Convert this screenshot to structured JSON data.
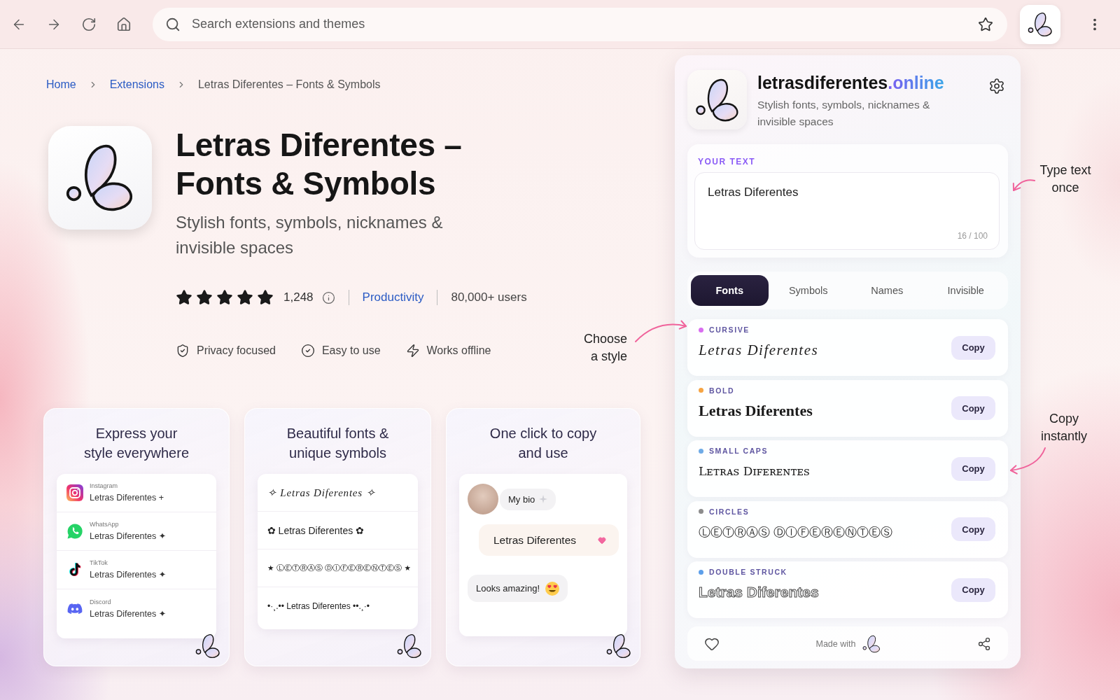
{
  "browser": {
    "search": {
      "placeholder": "Search extensions and themes"
    }
  },
  "breadcrumb": [
    {
      "label": "Home",
      "kind": "link"
    },
    {
      "label": "Extensions",
      "kind": "link"
    },
    {
      "label": "Letras Diferentes – Fonts & Symbols",
      "kind": "current"
    }
  ],
  "extension": {
    "title": "Letras Diferentes – Fonts & Symbols",
    "subtitle": "Stylish fonts, symbols, nicknames & invisible spaces",
    "stars": 5,
    "rating_count": "1,248",
    "category": "Productivity",
    "users": "80,000+ users",
    "features": [
      {
        "kind": "privacy",
        "label": "Privacy focused"
      },
      {
        "kind": "easy",
        "label": "Easy to use"
      },
      {
        "kind": "offline",
        "label": "Works offline"
      }
    ]
  },
  "showcase": [
    {
      "kind": "apps",
      "title": "Express your style everywhere",
      "rows": [
        {
          "kind": "instagram",
          "app": "Instagram",
          "text": "Letras Diferentes +"
        },
        {
          "kind": "whatsapp",
          "app": "WhatsApp",
          "text": "Letras Diferentes ✦"
        },
        {
          "kind": "tiktok",
          "app": "TikTok",
          "text": "Letras Diferentes ✦"
        },
        {
          "kind": "discord",
          "app": "Discord",
          "text": "Letras Diferentes ✦"
        }
      ]
    },
    {
      "kind": "symbols",
      "title": "Beautiful fonts & unique symbols",
      "rows": [
        {
          "kind": "italic",
          "text": "✧ Letras Diferentes ✧"
        },
        {
          "kind": "plain",
          "text": "✿ Letras Diferentes ✿"
        },
        {
          "kind": "circles",
          "text": "★ ⓁⒺⓉⓇⒶⓈ ⒹⒾⒻⒺⓇⒺⓃⓉⒺⓈ ★"
        },
        {
          "kind": "small",
          "text": "•·¸.•• Letras Diferentes ••.¸·•"
        }
      ]
    },
    {
      "kind": "chat",
      "title": "One click to copy and use",
      "messages": [
        {
          "kind": "bio",
          "text": "My bio"
        },
        {
          "kind": "highlight",
          "text": "Letras Diferentes"
        },
        {
          "kind": "reply",
          "text": "Looks amazing!"
        }
      ]
    }
  ],
  "panel": {
    "brand": "letrasdiferentes",
    "brand_accent": ".online",
    "tagline": "Stylish fonts, symbols, nicknames & invisible spaces",
    "input": {
      "label": "YOUR TEXT",
      "value": "Letras Diferentes",
      "count": "16 / 100"
    },
    "tabs": [
      {
        "label": "Fonts",
        "selected": true
      },
      {
        "label": "Symbols",
        "selected": false
      },
      {
        "label": "Names",
        "selected": false
      },
      {
        "label": "Invisible",
        "selected": false
      }
    ],
    "fonts": [
      {
        "kind": "cursive",
        "label": "CURSIVE",
        "color": "#d86ef0",
        "sample": "Letras Diferentes",
        "button": "Copy"
      },
      {
        "kind": "bold",
        "label": "BOLD",
        "color": "#f6a443",
        "sample": "Letras Diferentes",
        "button": "Copy"
      },
      {
        "kind": "small_caps",
        "label": "SMALL CAPS",
        "color": "#6fabe6",
        "sample": "Lᴇᴛʀᴀꜱ Dɪꜰᴇʀᴇɴᴛᴇꜱ",
        "button": "Copy"
      },
      {
        "kind": "circles",
        "label": "CIRCLES",
        "color": "#8c8c8c",
        "sample": "ⓁⒺⓉⓇⒶⓈ ⒹⒾⒻⒺⓇⒺⓃⓉⒺⓈ",
        "button": "Copy"
      },
      {
        "kind": "double_struck",
        "label": "DOUBLE STRUCK",
        "color": "#5c9fea",
        "sample": "Letras Diferentes",
        "button": "Copy"
      }
    ],
    "footer": {
      "text": "Made with"
    }
  },
  "annotations": {
    "type_text": "Type text once",
    "choose_style": "Choose a style",
    "copy": "Copy instantly"
  }
}
